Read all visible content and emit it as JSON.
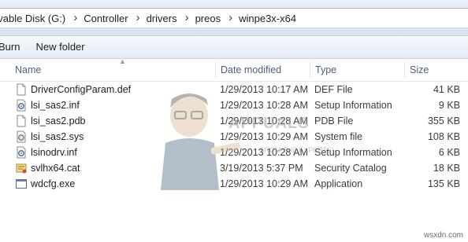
{
  "address": {
    "crumbs": [
      "ovable Disk (G:)",
      "Controller",
      "drivers",
      "preos",
      "winpe3x-x64"
    ]
  },
  "toolbar": {
    "burn_label": "Burn",
    "new_folder_label": "New folder"
  },
  "columns": {
    "name": "Name",
    "date": "Date modified",
    "type": "Type",
    "size": "Size"
  },
  "files": [
    {
      "name": "DriverConfigParam.def",
      "date": "1/29/2013 10:17 AM",
      "type": "DEF File",
      "size": "41 KB",
      "icon": "blank-file-icon"
    },
    {
      "name": "lsi_sas2.inf",
      "date": "1/29/2013 10:28 AM",
      "type": "Setup Information",
      "size": "9 KB",
      "icon": "setup-info-icon"
    },
    {
      "name": "lsi_sas2.pdb",
      "date": "1/29/2013 10:28 AM",
      "type": "PDB File",
      "size": "355 KB",
      "icon": "blank-file-icon"
    },
    {
      "name": "lsi_sas2.sys",
      "date": "1/29/2013 10:29 AM",
      "type": "System file",
      "size": "108 KB",
      "icon": "system-file-icon"
    },
    {
      "name": "lsinodrv.inf",
      "date": "1/29/2013 10:28 AM",
      "type": "Setup Information",
      "size": "6 KB",
      "icon": "setup-info-icon"
    },
    {
      "name": "svlhx64.cat",
      "date": "3/19/2013 5:37 PM",
      "type": "Security Catalog",
      "size": "18 KB",
      "icon": "security-catalog-icon"
    },
    {
      "name": "wdcfg.exe",
      "date": "1/29/2013 10:29 AM",
      "type": "Application",
      "size": "135 KB",
      "icon": "application-icon"
    }
  ],
  "watermark": {
    "brand": "APPUALS",
    "tagline": "FROM THE EXPERTS!"
  },
  "site_label": "wsxdn.com"
}
